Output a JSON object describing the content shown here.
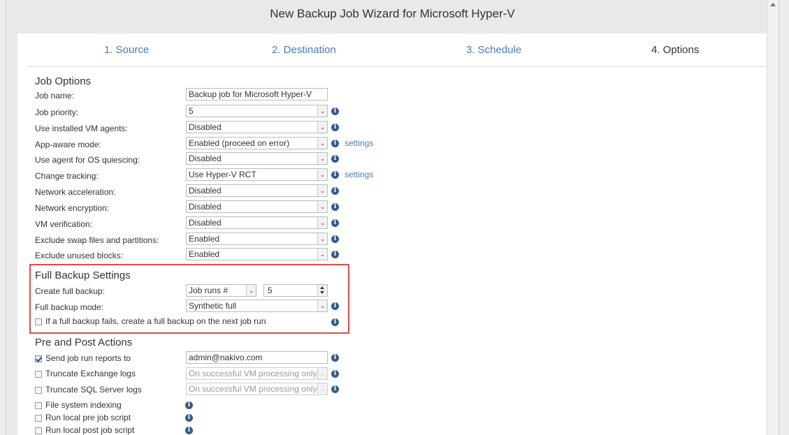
{
  "window": {
    "title": "New Backup Job Wizard for Microsoft Hyper-V"
  },
  "steps": [
    {
      "label": "1. Source"
    },
    {
      "label": "2. Destination"
    },
    {
      "label": "3. Schedule"
    },
    {
      "label": "4. Options"
    }
  ],
  "job_options": {
    "title": "Job Options",
    "job_name": {
      "label": "Job name:",
      "value": "Backup job for Microsoft Hyper-V"
    },
    "rows": [
      {
        "label": "Job priority:",
        "value": "5"
      },
      {
        "label": "Use installed VM agents:",
        "value": "Disabled"
      },
      {
        "label": "App-aware mode:",
        "value": "Enabled (proceed on error)",
        "link": "settings"
      },
      {
        "label": "Use agent for OS quiescing:",
        "value": "Disabled"
      },
      {
        "label": "Change tracking:",
        "value": "Use Hyper-V RCT",
        "link": "settings"
      },
      {
        "label": "Network acceleration:",
        "value": "Disabled"
      },
      {
        "label": "Network encryption:",
        "value": "Disabled"
      },
      {
        "label": "VM verification:",
        "value": "Disabled"
      },
      {
        "label": "Exclude swap files and partitions:",
        "value": "Enabled"
      },
      {
        "label": "Exclude unused blocks:",
        "value": "Enabled"
      }
    ]
  },
  "full_backup": {
    "title": "Full Backup Settings",
    "create_label": "Create full backup:",
    "create_select": "Job runs #",
    "create_count": "5",
    "mode_label": "Full backup mode:",
    "mode_value": "Synthetic full",
    "fail_checkbox": {
      "label": "If a full backup fails, create a full backup on the next job run",
      "checked": false
    }
  },
  "pre_post": {
    "title": "Pre and Post Actions",
    "send_reports": {
      "label": "Send job run reports to",
      "checked": true,
      "value": "admin@nakivo.com"
    },
    "truncate_exchange": {
      "label": "Truncate Exchange logs",
      "checked": false,
      "value": "On successful VM processing only"
    },
    "truncate_sql": {
      "label": "Truncate SQL Server logs",
      "checked": false,
      "value": "On successful VM processing only"
    },
    "fs_indexing": {
      "label": "File system indexing",
      "checked": false
    },
    "pre_script": {
      "label": "Run local pre job script",
      "checked": false
    },
    "post_script": {
      "label": "Run local post job script",
      "checked": false
    }
  },
  "icons": {
    "info": "info-icon",
    "dropdown": "chevron-down-icon"
  },
  "info_glyph": "i",
  "arrow_glyph": "⌄",
  "colors": {
    "accent": "#4a7bb7",
    "info": "#345b8a",
    "highlight": "#e24a4a"
  }
}
